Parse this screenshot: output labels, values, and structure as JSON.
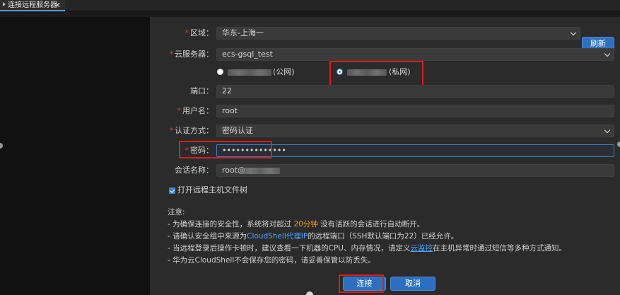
{
  "tab": {
    "title": "连接远程服务器",
    "close": "✕"
  },
  "form": {
    "region": {
      "label": "区域：",
      "value": "华东-上海一",
      "refresh": "刷新"
    },
    "server": {
      "label": "云服务器：",
      "value": "ecs-gsql_test"
    },
    "network": {
      "public_suffix": "(公网)",
      "private_suffix": "(私网)",
      "selected": "private"
    },
    "port": {
      "label": "端口：",
      "value": "22"
    },
    "username": {
      "label": "用户名：",
      "value": "root"
    },
    "auth": {
      "label": "认证方式：",
      "value": "密码认证"
    },
    "password": {
      "label": "密码：",
      "value": "••••••••••••••"
    },
    "session": {
      "label": "会话名称：",
      "value": "root@"
    },
    "filetree": {
      "label": "打开远程主机文件树",
      "checked": true
    }
  },
  "notes": {
    "title": "注意:",
    "l1_a": "- 为确保连接的安全性，系统将对超过 ",
    "l1_hl": "20分钟",
    "l1_b": " 没有活跃的会话进行自动断开。",
    "l2_a": "- 请确认安全组中来源为",
    "l2_link": "CloudShell代理IP",
    "l2_b": "的远程端口（SSH默认端口为22）已经允许。",
    "l3_a": "- 当远程登录后操作卡顿时，建议查看一下机器的CPU、内存情况，请定义",
    "l3_link": "云监控",
    "l3_b": "在主机异常时通过短信等多种方式通知。",
    "l4": "- 华为云CloudShell不会保存您的密码，请妥善保管以防丢失。"
  },
  "buttons": {
    "connect": "连接",
    "cancel": "取消"
  },
  "colors": {
    "accent": "#2f6fc2",
    "highlight_box": "#d81e1e",
    "warning": "#e8a000",
    "link": "#4ea3ff"
  }
}
